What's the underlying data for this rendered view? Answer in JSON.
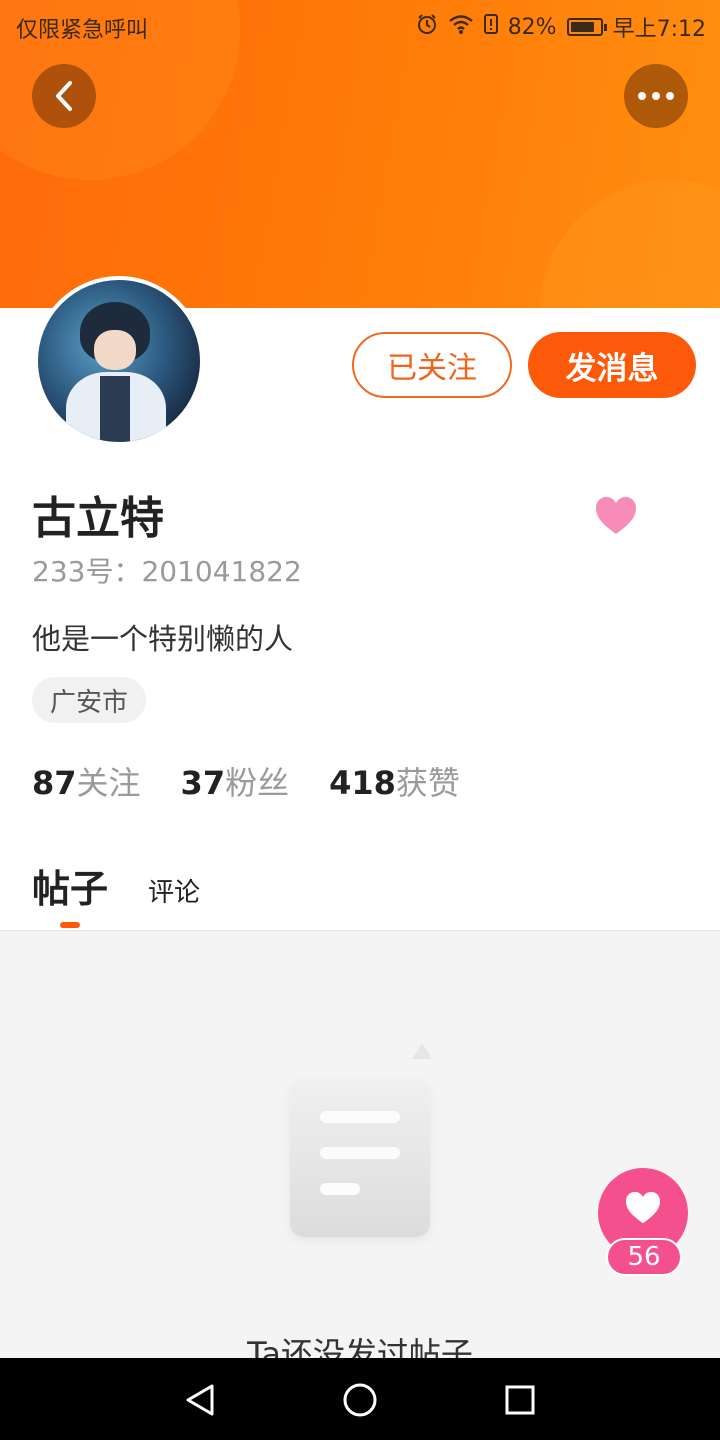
{
  "status_bar": {
    "carrier_text": "仅限紧急呼叫",
    "battery_percent": "82%",
    "battery_level": 0.82,
    "time": "早上7:12",
    "icons": [
      "alarm-icon",
      "wifi-icon",
      "battery-saver-icon",
      "battery-icon"
    ]
  },
  "header": {
    "back_icon": "chevron-left-icon",
    "more_icon": "more-dots-icon"
  },
  "profile": {
    "follow_button_label": "已关注",
    "message_button_label": "发消息",
    "name": "古立特",
    "uid": "233号：201041822",
    "bio": "他是一个特别懒的人",
    "location": "广安市",
    "stats": [
      {
        "num": "87",
        "label": "关注"
      },
      {
        "num": "37",
        "label": "粉丝"
      },
      {
        "num": "418",
        "label": "获赞"
      }
    ]
  },
  "tabs": [
    {
      "label": "帖子",
      "active": true
    },
    {
      "label": "评论",
      "active": false
    }
  ],
  "empty_state": {
    "text": "Ta还没发过帖子"
  },
  "floating_like": {
    "count": "56"
  },
  "colors": {
    "accent": "#fc5a0a",
    "like_pink": "#f5508e",
    "header_orange": "#ff7a08"
  }
}
